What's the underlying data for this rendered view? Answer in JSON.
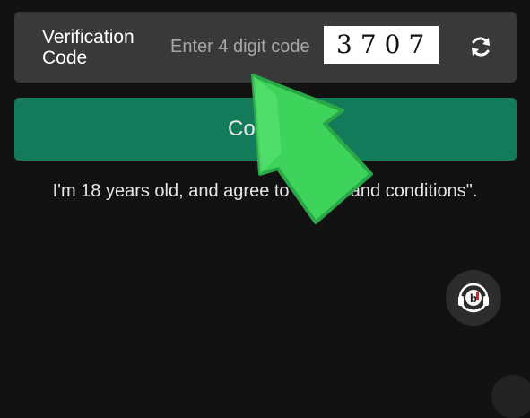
{
  "verification": {
    "label": "Verification Code",
    "input_placeholder": "Enter 4 digit code",
    "input_value": "",
    "captcha_code": "3707",
    "refresh_icon": "refresh-icon"
  },
  "confirm": {
    "label": "Confirm"
  },
  "agreement": {
    "text": "I'm 18 years old, and agree to \"terms and conditions\"."
  },
  "support": {
    "icon": "headset-support-icon"
  },
  "overlay": {
    "icon": "green-arrow-pointer-icon"
  },
  "colors": {
    "background": "#121212",
    "panel": "#393939",
    "confirm_green": "#137a5a",
    "pointer_green": "#3ed35a"
  }
}
